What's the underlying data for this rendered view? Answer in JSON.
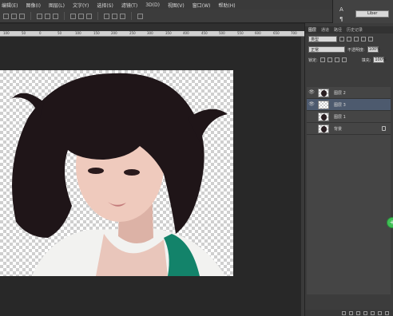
{
  "menu": {
    "items": [
      "编辑(E)",
      "图像(I)",
      "图层(L)",
      "文字(Y)",
      "选择(S)",
      "滤镜(T)",
      "3D(D)",
      "视图(V)",
      "窗口(W)",
      "帮助(H)"
    ]
  },
  "ruler": {
    "ticks": [
      "100",
      "50",
      "0",
      "50",
      "100",
      "150",
      "200",
      "250",
      "300",
      "350",
      "400",
      "450",
      "500",
      "550",
      "600",
      "650",
      "700"
    ]
  },
  "char_panel": {
    "icons": [
      "type-a-icon",
      "paragraph-icon"
    ],
    "font_name": "Liber"
  },
  "layers_panel": {
    "tabs": [
      "图层",
      "通道",
      "路径",
      "历史记录"
    ],
    "filter_select": "类型",
    "blend_mode": "正常",
    "opacity_label": "不透明度:",
    "opacity_value": "100%",
    "lock_label": "锁定:",
    "fill_label": "填充:",
    "fill_value": "100%",
    "layers": [
      {
        "name": "图层 2",
        "visible": true,
        "selected": false
      },
      {
        "name": "图层 3",
        "visible": true,
        "selected": true
      },
      {
        "name": "图层 1",
        "visible": false,
        "selected": false
      },
      {
        "name": "背景",
        "visible": false,
        "selected": false,
        "locked": true
      }
    ]
  },
  "colors": {
    "ui_dark": "#282828",
    "panel": "#3c3c3c",
    "selected_layer": "#4d5a6e",
    "badge": "#3fbf55"
  }
}
